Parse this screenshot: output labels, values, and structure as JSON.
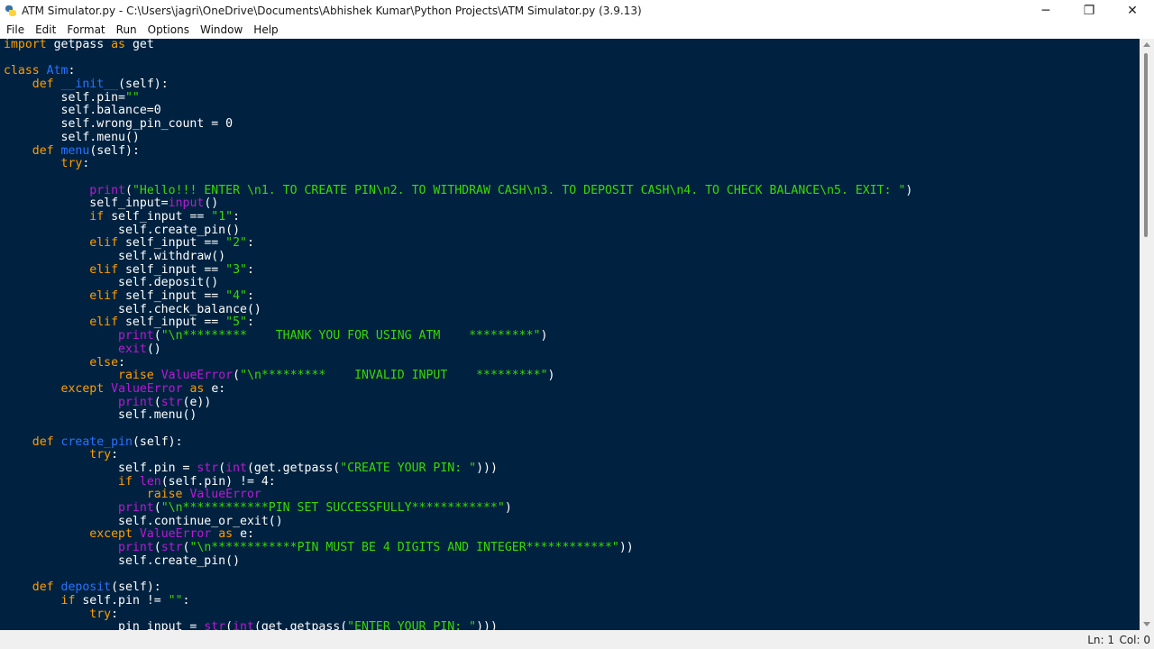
{
  "window": {
    "title": "ATM Simulator.py - C:\\Users\\jagri\\OneDrive\\Documents\\Abhishek Kumar\\Python Projects\\ATM Simulator.py (3.9.13)",
    "icon": "python-file-icon",
    "controls": {
      "minimize": "─",
      "maximize": "❐",
      "close": "✕"
    }
  },
  "menu": [
    "File",
    "Edit",
    "Format",
    "Run",
    "Options",
    "Window",
    "Help"
  ],
  "colors": {
    "editor_bg": "#002240",
    "keyword": "#ff9d00",
    "builtin": "#b919d6",
    "string": "#3ad900",
    "definition": "#2a72ff",
    "identifier": "#ffffff"
  },
  "code_lines": [
    [
      [
        "kw",
        "import"
      ],
      [
        "id",
        " getpass "
      ],
      [
        "kw",
        "as"
      ],
      [
        "id",
        " get"
      ]
    ],
    [],
    [
      [
        "kw",
        "class"
      ],
      [
        "id",
        " "
      ],
      [
        "df",
        "Atm"
      ],
      [
        "id",
        ":"
      ]
    ],
    [
      [
        "id",
        "    "
      ],
      [
        "kw",
        "def"
      ],
      [
        "id",
        " "
      ],
      [
        "df",
        "__init__"
      ],
      [
        "id",
        "(self):"
      ]
    ],
    [
      [
        "id",
        "        self.pin="
      ],
      [
        "st",
        "\"\""
      ]
    ],
    [
      [
        "id",
        "        self.balance=0"
      ]
    ],
    [
      [
        "id",
        "        self.wrong_pin_count = 0"
      ]
    ],
    [
      [
        "id",
        "        self.menu()"
      ]
    ],
    [
      [
        "id",
        "    "
      ],
      [
        "kw",
        "def"
      ],
      [
        "id",
        " "
      ],
      [
        "df",
        "menu"
      ],
      [
        "id",
        "(self):"
      ]
    ],
    [
      [
        "id",
        "        "
      ],
      [
        "kw",
        "try"
      ],
      [
        "id",
        ":"
      ]
    ],
    [],
    [
      [
        "id",
        "            "
      ],
      [
        "bi",
        "print"
      ],
      [
        "id",
        "("
      ],
      [
        "st",
        "\"Hello!!! ENTER \\n1. TO CREATE PIN\\n2. TO WITHDRAW CASH\\n3. TO DEPOSIT CASH\\n4. TO CHECK BALANCE\\n5. EXIT: \""
      ],
      [
        "id",
        ")"
      ]
    ],
    [
      [
        "id",
        "            self_input="
      ],
      [
        "bi",
        "input"
      ],
      [
        "id",
        "()"
      ]
    ],
    [
      [
        "id",
        "            "
      ],
      [
        "kw",
        "if"
      ],
      [
        "id",
        " self_input == "
      ],
      [
        "st",
        "\"1\""
      ],
      [
        "id",
        ":"
      ]
    ],
    [
      [
        "id",
        "                self.create_pin()"
      ]
    ],
    [
      [
        "id",
        "            "
      ],
      [
        "kw",
        "elif"
      ],
      [
        "id",
        " self_input == "
      ],
      [
        "st",
        "\"2\""
      ],
      [
        "id",
        ":"
      ]
    ],
    [
      [
        "id",
        "                self.withdraw()"
      ]
    ],
    [
      [
        "id",
        "            "
      ],
      [
        "kw",
        "elif"
      ],
      [
        "id",
        " self_input == "
      ],
      [
        "st",
        "\"3\""
      ],
      [
        "id",
        ":"
      ]
    ],
    [
      [
        "id",
        "                self.deposit()"
      ]
    ],
    [
      [
        "id",
        "            "
      ],
      [
        "kw",
        "elif"
      ],
      [
        "id",
        " self_input == "
      ],
      [
        "st",
        "\"4\""
      ],
      [
        "id",
        ":"
      ]
    ],
    [
      [
        "id",
        "                self.check_balance()"
      ]
    ],
    [
      [
        "id",
        "            "
      ],
      [
        "kw",
        "elif"
      ],
      [
        "id",
        " self_input == "
      ],
      [
        "st",
        "\"5\""
      ],
      [
        "id",
        ":"
      ]
    ],
    [
      [
        "id",
        "                "
      ],
      [
        "bi",
        "print"
      ],
      [
        "id",
        "("
      ],
      [
        "st",
        "\"\\n*********    THANK YOU FOR USING ATM    *********\""
      ],
      [
        "id",
        ")"
      ]
    ],
    [
      [
        "id",
        "                "
      ],
      [
        "bi",
        "exit"
      ],
      [
        "id",
        "()"
      ]
    ],
    [
      [
        "id",
        "            "
      ],
      [
        "kw",
        "else"
      ],
      [
        "id",
        ":"
      ]
    ],
    [
      [
        "id",
        "                "
      ],
      [
        "kw",
        "raise"
      ],
      [
        "id",
        " "
      ],
      [
        "bi",
        "ValueError"
      ],
      [
        "id",
        "("
      ],
      [
        "st",
        "\"\\n*********    INVALID INPUT    *********\""
      ],
      [
        "id",
        ")"
      ]
    ],
    [
      [
        "id",
        "        "
      ],
      [
        "kw",
        "except"
      ],
      [
        "id",
        " "
      ],
      [
        "bi",
        "ValueError"
      ],
      [
        "id",
        " "
      ],
      [
        "kw",
        "as"
      ],
      [
        "id",
        " e:"
      ]
    ],
    [
      [
        "id",
        "                "
      ],
      [
        "bi",
        "print"
      ],
      [
        "id",
        "("
      ],
      [
        "bi",
        "str"
      ],
      [
        "id",
        "(e))"
      ]
    ],
    [
      [
        "id",
        "                self.menu()"
      ]
    ],
    [],
    [
      [
        "id",
        "    "
      ],
      [
        "kw",
        "def"
      ],
      [
        "id",
        " "
      ],
      [
        "df",
        "create_pin"
      ],
      [
        "id",
        "(self):"
      ]
    ],
    [
      [
        "id",
        "            "
      ],
      [
        "kw",
        "try"
      ],
      [
        "id",
        ":"
      ]
    ],
    [
      [
        "id",
        "                self.pin = "
      ],
      [
        "bi",
        "str"
      ],
      [
        "id",
        "("
      ],
      [
        "bi",
        "int"
      ],
      [
        "id",
        "(get.getpass("
      ],
      [
        "st",
        "\"CREATE YOUR PIN: \""
      ],
      [
        "id",
        ")))"
      ]
    ],
    [
      [
        "id",
        "                "
      ],
      [
        "kw",
        "if"
      ],
      [
        "id",
        " "
      ],
      [
        "bi",
        "len"
      ],
      [
        "id",
        "(self.pin) != 4:"
      ]
    ],
    [
      [
        "id",
        "                    "
      ],
      [
        "kw",
        "raise"
      ],
      [
        "id",
        " "
      ],
      [
        "bi",
        "ValueError"
      ]
    ],
    [
      [
        "id",
        "                "
      ],
      [
        "bi",
        "print"
      ],
      [
        "id",
        "("
      ],
      [
        "st",
        "\"\\n************PIN SET SUCCESSFULLY************\""
      ],
      [
        "id",
        ")"
      ]
    ],
    [
      [
        "id",
        "                self.continue_or_exit()"
      ]
    ],
    [
      [
        "id",
        "            "
      ],
      [
        "kw",
        "except"
      ],
      [
        "id",
        " "
      ],
      [
        "bi",
        "ValueError"
      ],
      [
        "id",
        " "
      ],
      [
        "kw",
        "as"
      ],
      [
        "id",
        " e:"
      ]
    ],
    [
      [
        "id",
        "                "
      ],
      [
        "bi",
        "print"
      ],
      [
        "id",
        "("
      ],
      [
        "bi",
        "str"
      ],
      [
        "id",
        "("
      ],
      [
        "st",
        "\"\\n************PIN MUST BE 4 DIGITS AND INTEGER************\""
      ],
      [
        "id",
        "))"
      ]
    ],
    [
      [
        "id",
        "                self.create_pin()"
      ]
    ],
    [],
    [
      [
        "id",
        "    "
      ],
      [
        "kw",
        "def"
      ],
      [
        "id",
        " "
      ],
      [
        "df",
        "deposit"
      ],
      [
        "id",
        "(self):"
      ]
    ],
    [
      [
        "id",
        "        "
      ],
      [
        "kw",
        "if"
      ],
      [
        "id",
        " self.pin != "
      ],
      [
        "st",
        "\"\""
      ],
      [
        "id",
        ":"
      ]
    ],
    [
      [
        "id",
        "            "
      ],
      [
        "kw",
        "try"
      ],
      [
        "id",
        ":"
      ]
    ],
    [
      [
        "id",
        "                pin_input = "
      ],
      [
        "bi",
        "str"
      ],
      [
        "id",
        "("
      ],
      [
        "bi",
        "int"
      ],
      [
        "id",
        "(get.getpass("
      ],
      [
        "st",
        "\"ENTER YOUR PIN: \""
      ],
      [
        "id",
        ")))"
      ]
    ]
  ],
  "status": {
    "line": "Ln: 1",
    "col": "Col: 0"
  }
}
